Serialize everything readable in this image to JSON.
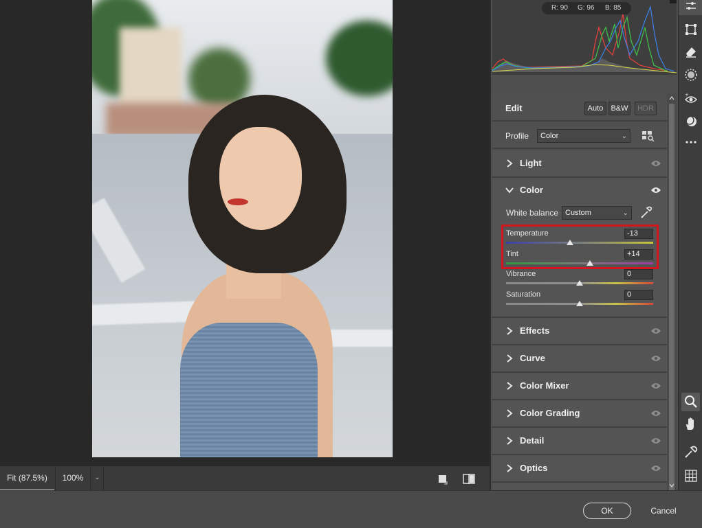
{
  "zoom": {
    "fit_label": "Fit (87.5%)",
    "percent_label": "100%"
  },
  "histogram": {
    "r_label": "R: 90",
    "g_label": "G: 96",
    "b_label": "B: 85"
  },
  "edit": {
    "title": "Edit",
    "auto_label": "Auto",
    "bw_label": "B&W",
    "hdr_label": "HDR"
  },
  "profile": {
    "label": "Profile",
    "value": "Color"
  },
  "sections": {
    "light": "Light",
    "color": "Color",
    "effects": "Effects",
    "curve": "Curve",
    "color_mixer": "Color Mixer",
    "color_grading": "Color Grading",
    "detail": "Detail",
    "optics": "Optics"
  },
  "color_panel": {
    "white_balance_label": "White balance",
    "white_balance_value": "Custom",
    "sliders": [
      {
        "label": "Temperature",
        "value": "-13",
        "position": 0.435
      },
      {
        "label": "Tint",
        "value": "+14",
        "position": 0.57
      },
      {
        "label": "Vibrance",
        "value": "0",
        "position": 0.5
      },
      {
        "label": "Saturation",
        "value": "0",
        "position": 0.5
      }
    ]
  },
  "footer": {
    "ok_label": "OK",
    "cancel_label": "Cancel"
  },
  "colors": {
    "highlight": "#d4151d",
    "accent_text": "#f0f0f0"
  }
}
